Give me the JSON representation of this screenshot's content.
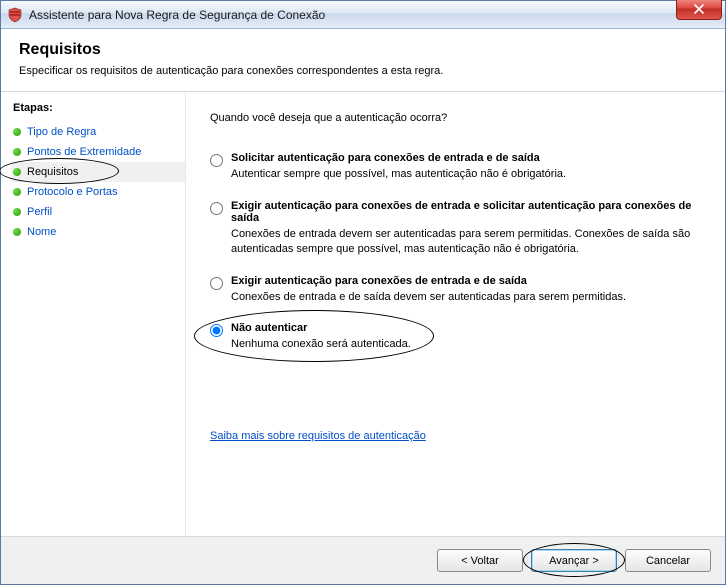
{
  "titlebar": {
    "title": "Assistente para Nova Regra de Segurança de Conexão"
  },
  "header": {
    "heading": "Requisitos",
    "subtitle": "Especificar os requisitos de autenticação para conexões correspondentes a esta regra."
  },
  "sidebar": {
    "steps_label": "Etapas:",
    "items": [
      {
        "label": "Tipo de Regra"
      },
      {
        "label": "Pontos de Extremidade"
      },
      {
        "label": "Requisitos"
      },
      {
        "label": "Protocolo e Portas"
      },
      {
        "label": "Perfil"
      },
      {
        "label": "Nome"
      }
    ],
    "current_index": 2
  },
  "content": {
    "question": "Quando você deseja que a autenticação ocorra?",
    "options": [
      {
        "title": "Solicitar autenticação para conexões de entrada e de saída",
        "desc": "Autenticar sempre que possível, mas autenticação não é obrigatória."
      },
      {
        "title": "Exigir autenticação para conexões de entrada e solicitar autenticação para conexões de saída",
        "desc": "Conexões de entrada devem ser autenticadas para serem permitidas. Conexões de saída são autenticadas sempre que possível, mas autenticação não é obrigatória."
      },
      {
        "title": "Exigir autenticação para conexões de entrada e de saída",
        "desc": "Conexões de entrada e de saída devem ser autenticadas para serem permitidas."
      },
      {
        "title": "Não autenticar",
        "desc": "Nenhuma conexão será autenticada."
      }
    ],
    "selected_index": 3,
    "learn_more": "Saiba mais sobre requisitos de autenticação"
  },
  "footer": {
    "back": "< Voltar",
    "next": "Avançar >",
    "cancel": "Cancelar"
  }
}
